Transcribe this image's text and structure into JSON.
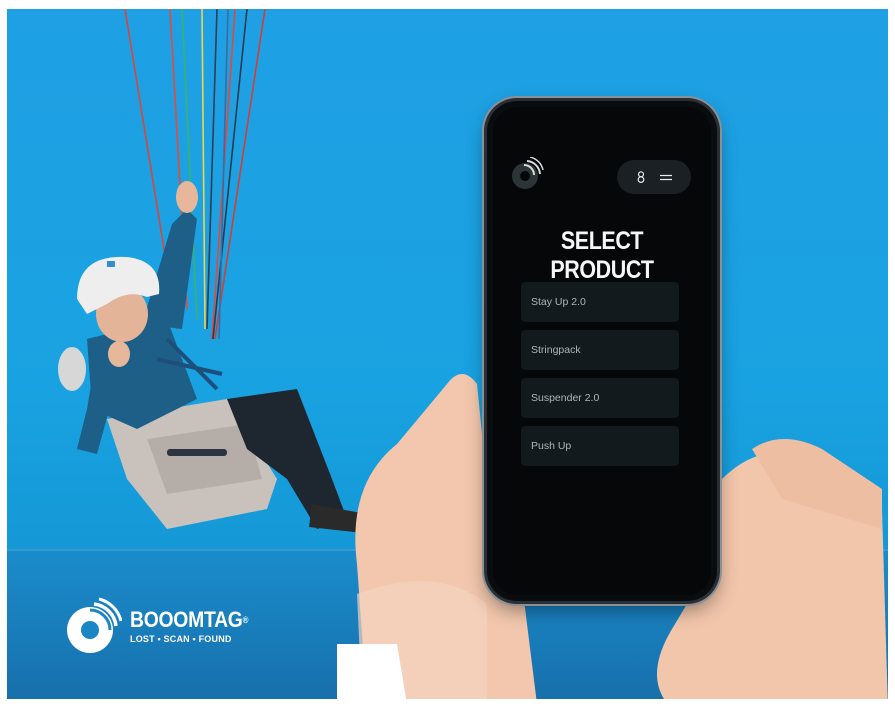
{
  "app": {
    "title": "SELECT PRODUCT",
    "user_icon": "user-icon",
    "menu_icon": "menu-icon",
    "logo_icon": "booomtag-logo-icon",
    "products": [
      {
        "label": "Stay Up 2.0"
      },
      {
        "label": "Stringpack"
      },
      {
        "label": "Suspender 2.0"
      },
      {
        "label": "Push Up"
      }
    ]
  },
  "brand": {
    "name": "BOOOMTAG",
    "registered": "®",
    "tagline": "LOST • SCAN • FOUND"
  },
  "colors": {
    "sky": "#1fa0e4",
    "phone_bg": "#050708",
    "product_bg": "#121a1d",
    "title_text": "#f4f6f7"
  }
}
